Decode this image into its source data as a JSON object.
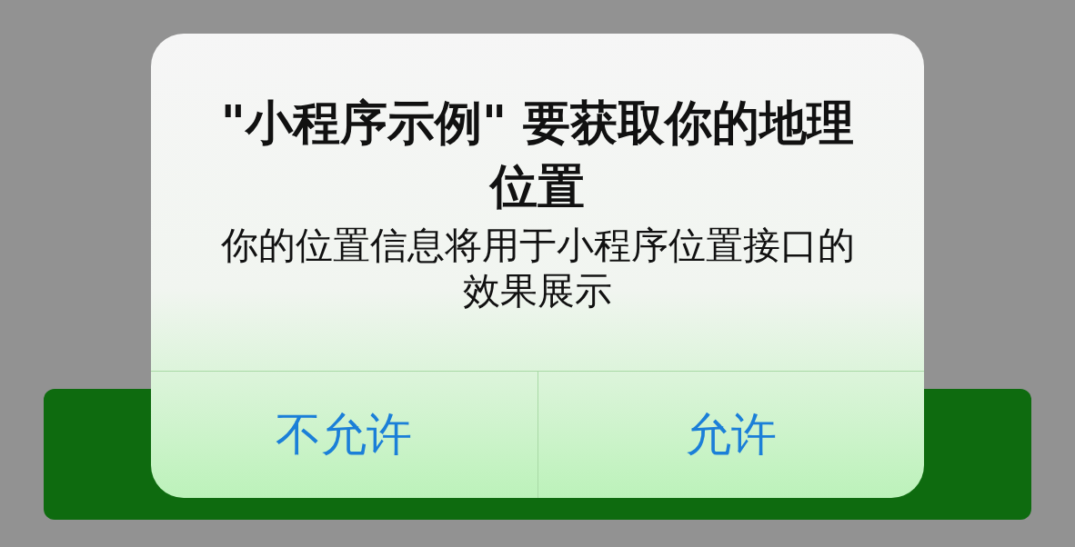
{
  "alert": {
    "title": "\"小程序示例\" 要获取你的地理位置",
    "message": "你的位置信息将用于小程序位置接口的效果展示",
    "buttons": [
      {
        "label": "不允许"
      },
      {
        "label": "允许"
      }
    ]
  }
}
